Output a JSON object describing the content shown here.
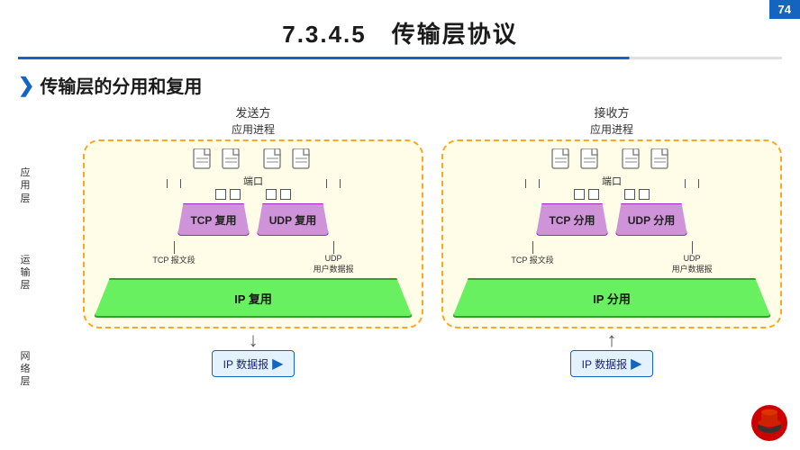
{
  "slide": {
    "number": "74",
    "title": "7.3.4.5　传输层协议",
    "section_title": "传输层的分用和复用",
    "section_arrow": "❯"
  },
  "labels": {
    "app_layer": "应\n用\n层",
    "transport_layer": "运\n输\n层",
    "network_layer": "网\n络\n层"
  },
  "sender": {
    "title": "发送方",
    "subtitle": "应用进程",
    "port_label": "端口",
    "tcp_label": "TCP 复用",
    "udp_label": "UDP 复用",
    "tcp_segment": "TCP 报文段",
    "udp_datagram": "UDP\n用户数据报",
    "ip_label": "IP 复用",
    "ip_packet": "IP 数据报"
  },
  "receiver": {
    "title": "接收方",
    "subtitle": "应用进程",
    "port_label": "端口",
    "tcp_label": "TCP 分用",
    "udp_label": "UDP 分用",
    "tcp_segment": "TCP 报文段",
    "udp_datagram": "UDP\n用户数据报",
    "ip_label": "IP 分用",
    "ip_packet": "IP 数据报"
  },
  "colors": {
    "accent_blue": "#1565c0",
    "yellow_bg": "#fffde7",
    "yellow_border": "#f9a825",
    "purple_proto": "#ce93d8",
    "green_ip": "#69f060",
    "datagram_bg": "#e3f2fd"
  }
}
